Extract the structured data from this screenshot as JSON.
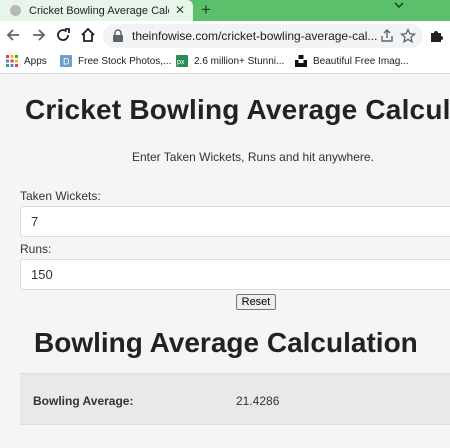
{
  "browser": {
    "tab_title": "Cricket Bowling Average Calculat",
    "close_glyph": "✕",
    "new_tab_glyph": "+",
    "url": "theinfowise.com/cricket-bowling-average-cal...",
    "bookmarks": [
      {
        "label": "Apps",
        "icon": "apps-grid-icon"
      },
      {
        "label": "Free Stock Photos,...",
        "icon": "stock-photos-icon"
      },
      {
        "label": "2.6 million+ Stunni...",
        "icon": "px-icon"
      },
      {
        "label": "Beautiful Free Imag...",
        "icon": "unsplash-icon"
      }
    ]
  },
  "page": {
    "title": "Cricket Bowling Average Calculator",
    "instructions": "Enter Taken Wickets, Runs and hit anywhere.",
    "wickets_label": "Taken Wickets:",
    "wickets_value": "7",
    "runs_label": "Runs:",
    "runs_value": "150",
    "reset_label": "Reset",
    "result_heading": "Bowling Average Calculation",
    "result_label": "Bowling Average:",
    "result_value": "21.4286"
  },
  "colors": {
    "tabstrip": "#5bbf6b",
    "page_bg": "#f5f5f6",
    "result_bg": "#e9e9e9"
  }
}
